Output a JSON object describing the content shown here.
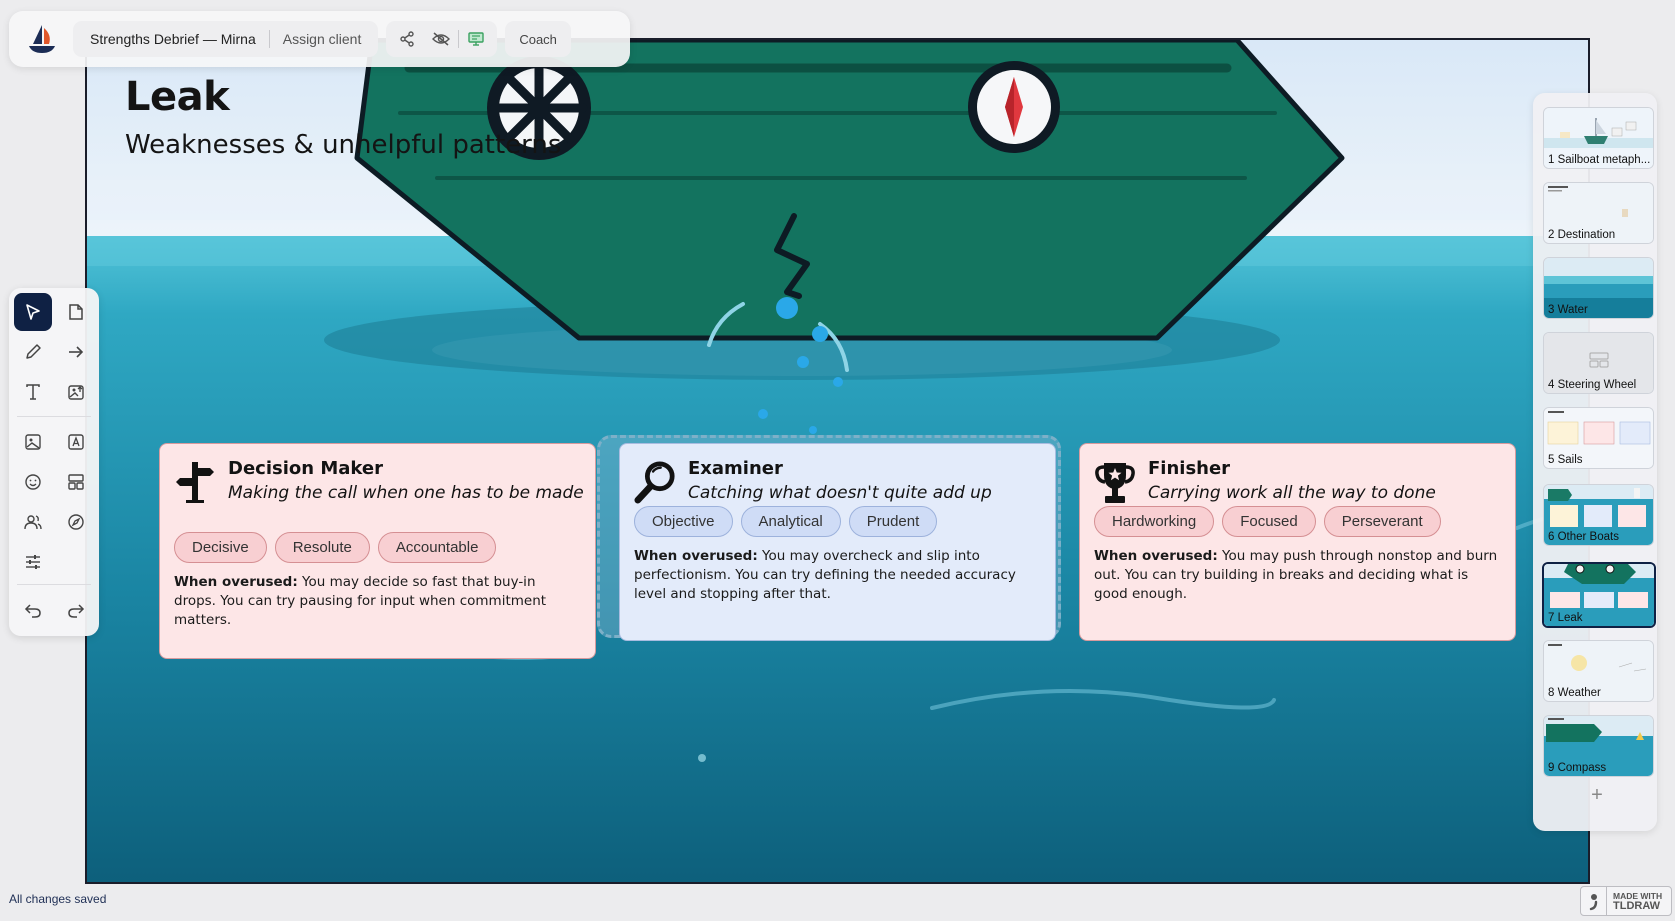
{
  "app": {
    "document_title": "Strengths Debrief — Mirna",
    "assign_client_label": "Assign client",
    "coach_label": "Coach",
    "status_text": "All changes saved",
    "made_with_top": "MADE WITH",
    "made_with_brand": "TLDRAW"
  },
  "toolbar": {
    "icons": [
      "share-icon",
      "hide-icon",
      "present-icon"
    ]
  },
  "left_tools": [
    "select-tool",
    "note-tool",
    "draw-tool",
    "arrow-tool",
    "text-tool",
    "image-upload-tool",
    "image-tool",
    "text-box-tool",
    "sticker-tool",
    "layout-tool",
    "people-tool",
    "compass-tool",
    "settings-tool",
    "undo-button",
    "redo-button"
  ],
  "slide": {
    "title": "Leak",
    "subtitle": "Weaknesses & unhelpful patterns",
    "cards": [
      {
        "name": "Decision Maker",
        "tagline": "Making the call when one has to be made",
        "chips": [
          "Decisive",
          "Resolute",
          "Accountable"
        ],
        "overused_label": "When overused:",
        "overused_text": " You may decide so fast that buy-in drops. You can try pausing for input when commitment matters.",
        "icon": "signpost-icon",
        "accent": "#fde6e7"
      },
      {
        "name": "Examiner",
        "tagline": "Catching what doesn't quite add up",
        "chips": [
          "Objective",
          "Analytical",
          "Prudent"
        ],
        "overused_label": "When overused:",
        "overused_text": " You may overcheck and slip into perfectionism. You can try defining the needed accuracy level and stopping after that.",
        "icon": "magnifier-icon",
        "accent": "#e3ebfa"
      },
      {
        "name": "Finisher",
        "tagline": "Carrying work all the way to done",
        "chips": [
          "Hardworking",
          "Focused",
          "Perseverant"
        ],
        "overused_label": "When overused:",
        "overused_text": " You may push through nonstop and burn out. You can try building in breaks and deciding what is good enough.",
        "icon": "trophy-icon",
        "accent": "#fde6e7"
      }
    ]
  },
  "slides": [
    {
      "label": "1 Sailboat metaph..."
    },
    {
      "label": "2 Destination"
    },
    {
      "label": "3 Water"
    },
    {
      "label": "4 Steering Wheel"
    },
    {
      "label": "5 Sails"
    },
    {
      "label": "6 Other Boats"
    },
    {
      "label": "7 Leak"
    },
    {
      "label": "8 Weather"
    },
    {
      "label": "9 Compass"
    }
  ],
  "active_slide": 7,
  "add_slide_label": "+",
  "colors": {
    "hull": "#13735f",
    "sea_top": "#4fc3d6",
    "sea_bottom": "#0f6883",
    "sky": "#e6f1fa",
    "leak_drop": "#2aa8e8",
    "accent_dark": "#0f2144"
  }
}
